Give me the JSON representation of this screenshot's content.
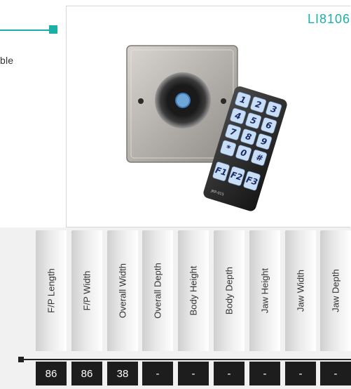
{
  "header": {
    "side_text": "ble",
    "product_code": "LI8106"
  },
  "product_image": {
    "icon": "keypad-reader-and-remote-image",
    "keypad_keys": [
      "1",
      "2",
      "3",
      "4",
      "5",
      "6",
      "7",
      "8",
      "9",
      "*",
      "0",
      "#",
      "F1",
      "F2",
      "F3"
    ],
    "remote_model": "JKP-015"
  },
  "specs": {
    "columns": [
      {
        "label": "F/P Length",
        "value": "86"
      },
      {
        "label": "F/P Width",
        "value": "86"
      },
      {
        "label": "Overall Width",
        "value": "38"
      },
      {
        "label": "Overall Depth",
        "value": "-"
      },
      {
        "label": "Body Height",
        "value": "-"
      },
      {
        "label": "Body Depth",
        "value": "-"
      },
      {
        "label": "Jaw Height",
        "value": "-"
      },
      {
        "label": "Jaw Width",
        "value": "-"
      },
      {
        "label": "Jaw Depth",
        "value": "-"
      }
    ]
  },
  "colors": {
    "accent": "#1ab0a8",
    "value_box": "#1d1d1d"
  }
}
